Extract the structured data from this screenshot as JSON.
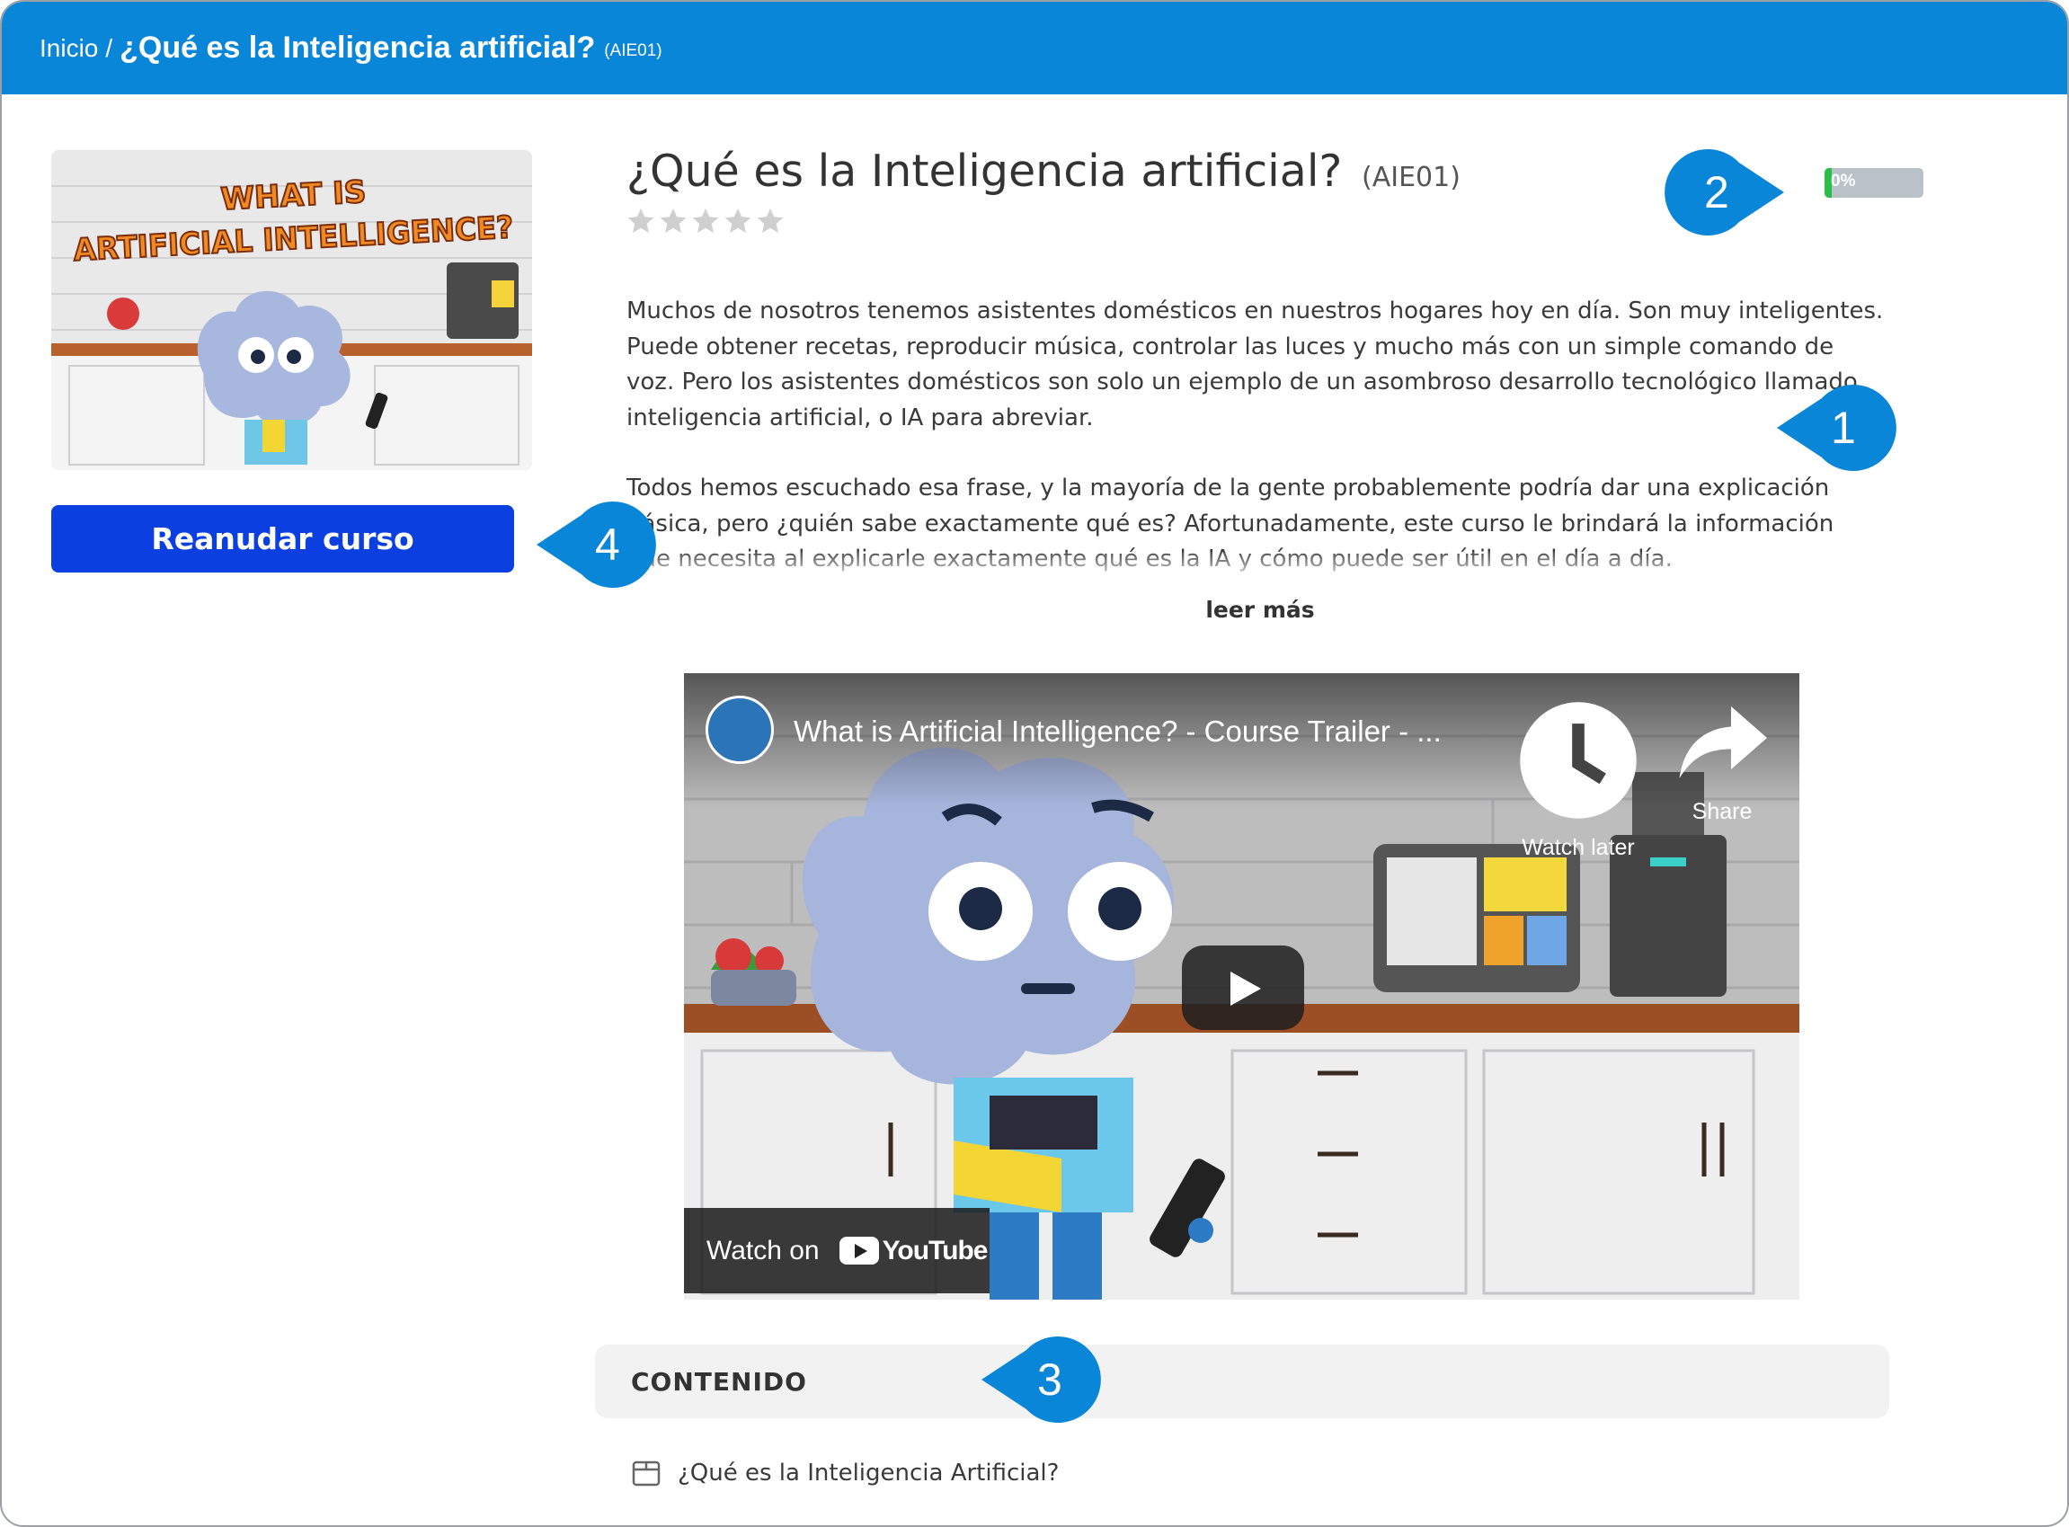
{
  "breadcrumb": {
    "home": "Inicio",
    "separator": "/",
    "title": "¿Qué es la Inteligencia artificial?",
    "code": "(AIE01)"
  },
  "course": {
    "title": "¿Qué es la Inteligencia artificial?",
    "code": "(AIE01)",
    "rating_stars": 5,
    "progress_label": "0%",
    "progress_value": 0,
    "resume_label": "Reanudar curso",
    "thumbnail_text": "WHAT IS ARTIFICIAL INTELLIGENCE?",
    "description": [
      "Muchos de nosotros tenemos asistentes domésticos en nuestros hogares hoy en día. Son muy inteligentes. Puede obtener recetas, reproducir música, controlar las luces y mucho más con un simple comando de voz. Pero los asistentes domésticos son solo un ejemplo de un asombroso desarrollo tecnológico llamado inteligencia artificial, o IA para abreviar.",
      "Todos hemos escuchado esa frase, y la mayoría de la gente probablemente podría dar una explicación básica, pero ¿quién sabe exactamente qué es? Afortunadamente, este curso le brindará la información que necesita al explicarle exactamente qué es la IA y cómo puede ser útil en el día a día."
    ],
    "read_more": "leer más"
  },
  "video": {
    "title": "What is Artificial Intelligence? - Course Trailer - ...",
    "watch_later": "Watch later",
    "share": "Share",
    "watch_on": "Watch on",
    "youtube": "YouTube"
  },
  "content": {
    "heading": "CONTENIDO",
    "lessons": [
      {
        "label": "¿Qué es la Inteligencia Artificial?"
      }
    ]
  },
  "callouts": [
    "1",
    "2",
    "3",
    "4"
  ],
  "colors": {
    "topbar": "#0a86d8",
    "button": "#0b3fe0",
    "callout": "#0a86d8",
    "progress_fill": "#2bbf4a"
  }
}
